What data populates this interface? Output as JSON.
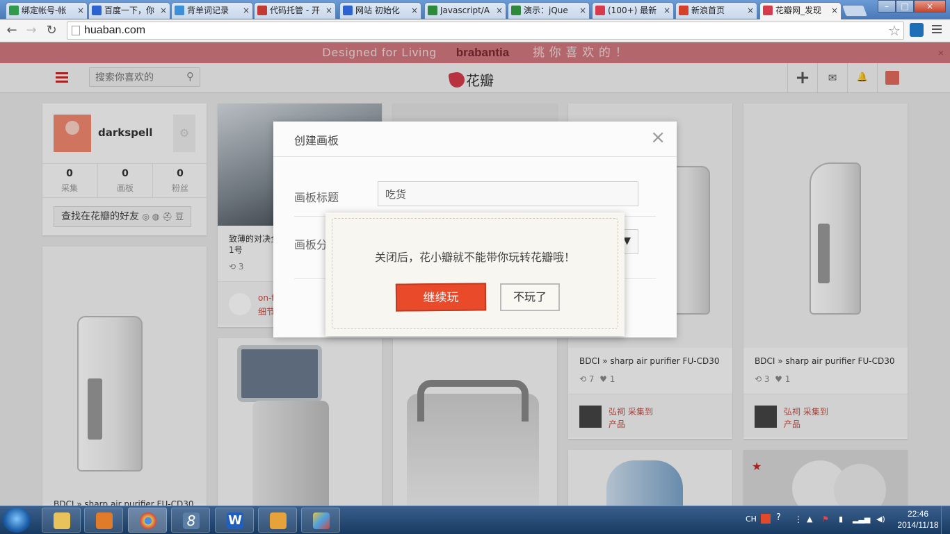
{
  "browser": {
    "tabs": [
      {
        "label": "绑定帐号-帐",
        "color": "#2e9a4a"
      },
      {
        "label": "百度一下，你",
        "color": "#2d63d0"
      },
      {
        "label": "背单词记录",
        "color": "#3d8fd6"
      },
      {
        "label": "代码托管 - 开",
        "color": "#c23a30"
      },
      {
        "label": "网站 初始化",
        "color": "#2d63d0"
      },
      {
        "label": "Javascript/A",
        "color": "#2e8a3a"
      },
      {
        "label": "演示：jQue",
        "color": "#2e8a3a"
      },
      {
        "label": "(100+) 最新",
        "color": "#d63c4b"
      },
      {
        "label": "新浪首页",
        "color": "#d4402a"
      },
      {
        "label": "花瓣网_发现",
        "color": "#d63c4b"
      }
    ],
    "tab_close": "×",
    "url": "huaban.com",
    "win_min": "–",
    "win_max": "□",
    "win_close": "×"
  },
  "banner": {
    "text_left": "Designed for Living",
    "brand": "brabantia",
    "text_right": "挑 你 喜 欢 的 ！",
    "close": "×"
  },
  "header": {
    "search_placeholder": "搜索你喜欢的",
    "logo_text": "花瓣",
    "add": "+",
    "mail": "✉",
    "bell": "🔔"
  },
  "profile": {
    "username": "darkspell",
    "stats": [
      {
        "value": "0",
        "label": "采集"
      },
      {
        "value": "0",
        "label": "画板"
      },
      {
        "value": "0",
        "label": "粉丝"
      }
    ],
    "find_friends": "查找在花瓣的好友"
  },
  "pins": {
    "p1": {
      "desc": "致薄的对决全",
      "desc2": "1号",
      "repins": "3",
      "via": "on-f",
      "board": "细节"
    },
    "p3": {
      "desc": "BDCI » sharp air purifier FU-CD30",
      "repins": "7",
      "likes": "1",
      "via": "弘祠 采集到",
      "board": "产品"
    },
    "p4": {
      "desc": "BDCI » sharp air purifier FU-CD30",
      "repins": "3",
      "likes": "1",
      "via": "弘祠 采集到",
      "board": "产品"
    },
    "p5": {
      "desc": "BDCI » sharp air purifier FU-CD30"
    }
  },
  "modal": {
    "title": "创建画板",
    "close": "×",
    "field_title_label": "画板标题",
    "field_title_value": "吃货",
    "field_category_label": "画板分",
    "category_arrow": "▼"
  },
  "confirm": {
    "message": "关闭后，花小瓣就不能带你玩转花瓣哦！",
    "continue_label": "继续玩",
    "quit_label": "不玩了"
  },
  "taskbar": {
    "clock_time": "22:46",
    "clock_date": "2014/11/18",
    "ime": "CH",
    "items": [
      "explorer",
      "media",
      "chrome",
      "app8",
      "wps",
      "home",
      "paint"
    ]
  }
}
